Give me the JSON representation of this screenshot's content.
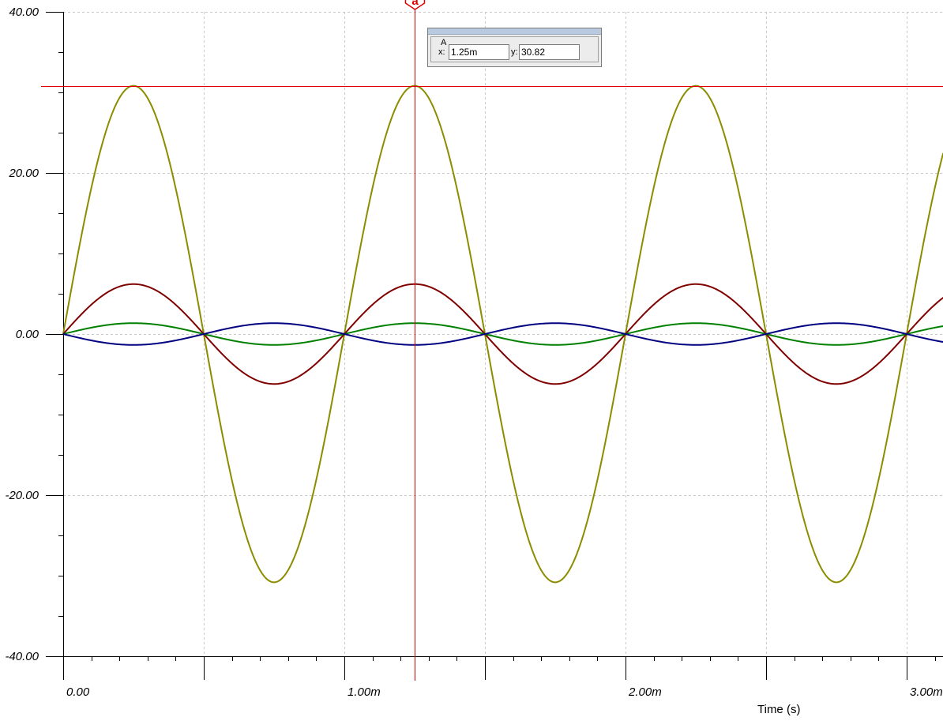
{
  "chart_data": {
    "type": "line",
    "xlabel": "Time (s)",
    "ylabel": "",
    "xlim": [
      0,
      0.00313
    ],
    "ylim": [
      -40,
      40
    ],
    "x_ticks": [
      {
        "value": 0,
        "label": "0.00"
      },
      {
        "value": 0.001,
        "label": "1.00m"
      },
      {
        "value": 0.002,
        "label": "2.00m"
      },
      {
        "value": 0.003,
        "label": "3.00m"
      }
    ],
    "y_ticks": [
      {
        "value": 40,
        "label": "40.00"
      },
      {
        "value": 20,
        "label": "20.00"
      },
      {
        "value": 0,
        "label": "0.00"
      },
      {
        "value": -20,
        "label": "-20.00"
      },
      {
        "value": -40,
        "label": "-40.00"
      }
    ],
    "grid": true,
    "series": [
      {
        "color": "#8c8c00",
        "amplitude": 30.82,
        "frequency_hz": 1000,
        "phase": "sine"
      },
      {
        "color": "#800000",
        "amplitude": 6.2,
        "frequency_hz": 1000,
        "phase": "sine"
      },
      {
        "color": "#008000",
        "amplitude": 1.35,
        "frequency_hz": 1000,
        "phase": "sine"
      },
      {
        "color": "#000080",
        "amplitude": -1.35,
        "frequency_hz": 1000,
        "phase": "sine"
      }
    ],
    "cursor": {
      "name": "a",
      "x": 0.00125,
      "y": 30.82,
      "color": "#e00000"
    }
  },
  "cursor_panel": {
    "group_label": "A",
    "x_label": "x:",
    "x_value": "1.25m",
    "y_label": "y:",
    "y_value": "30.82"
  }
}
